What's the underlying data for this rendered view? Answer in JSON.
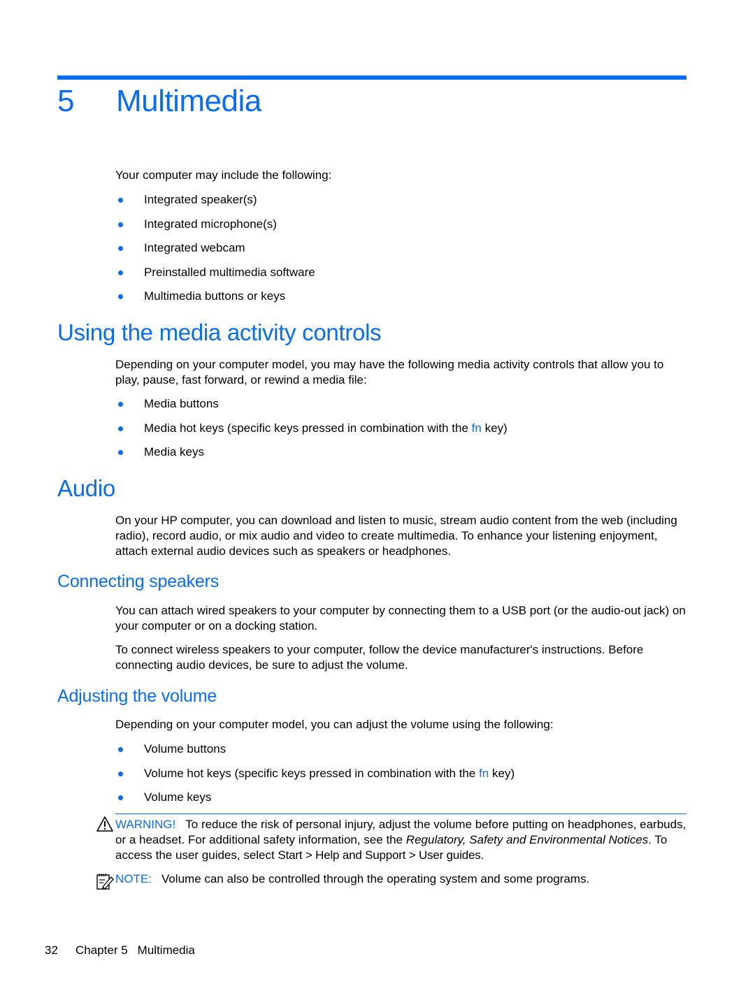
{
  "chapter": {
    "number": "5",
    "title": "Multimedia"
  },
  "intro": {
    "text": "Your computer may include the following:",
    "items": [
      "Integrated speaker(s)",
      "Integrated microphone(s)",
      "Integrated webcam",
      "Preinstalled multimedia software",
      "Multimedia buttons or keys"
    ]
  },
  "media_controls": {
    "heading": "Using the media activity controls",
    "text": "Depending on your computer model, you may have the following media activity controls that allow you to play, pause, fast forward, or rewind a media file:",
    "items": {
      "0": "Media buttons",
      "1_pre": "Media hot keys (specific keys pressed in combination with the ",
      "1_key": "fn",
      "1_post": " key)",
      "2": "Media keys"
    }
  },
  "audio": {
    "heading": "Audio",
    "text": "On your HP computer, you can download and listen to music, stream audio content from the web (including radio), record audio, or mix audio and video to create multimedia. To enhance your listening enjoyment, attach external audio devices such as speakers or headphones."
  },
  "connecting_speakers": {
    "heading": "Connecting speakers",
    "para1": "You can attach wired speakers to your computer by connecting them to a USB port (or the audio-out jack) on your computer or on a docking station.",
    "para2": "To connect wireless speakers to your computer, follow the device manufacturer's instructions. Before connecting audio devices, be sure to adjust the volume."
  },
  "adjusting_volume": {
    "heading": "Adjusting the volume",
    "text": "Depending on your computer model, you can adjust the volume using the following:",
    "items": {
      "0": "Volume buttons",
      "1_pre": "Volume hot keys (specific keys pressed in combination with the ",
      "1_key": "fn",
      "1_post": " key)",
      "2": "Volume keys"
    }
  },
  "warning": {
    "icon": "warning-triangle-icon",
    "label": "WARNING!",
    "text1": "To reduce the risk of personal injury, adjust the volume before putting on headphones, earbuds, or a headset. For additional safety information, see the ",
    "italic": "Regulatory, Safety and Environmental Notices",
    "text2": ". To access the user guides, select ",
    "path": "Start > Help and Support > User guides",
    "text3": "."
  },
  "note": {
    "icon": "note-pencil-icon",
    "label": "NOTE:",
    "text": "Volume can also be controlled through the operating system and some programs."
  },
  "footer": {
    "page": "32",
    "chapter": "Chapter 5",
    "title": "Multimedia"
  },
  "colors": {
    "accent": "#0a6cf0",
    "text": "#000000"
  }
}
